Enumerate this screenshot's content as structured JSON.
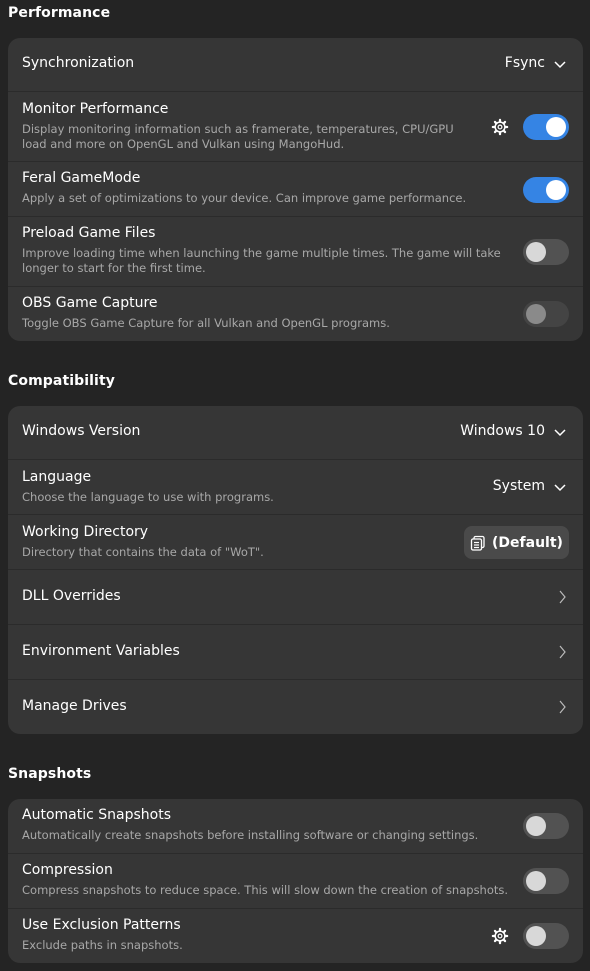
{
  "performance": {
    "title": "Performance",
    "synchronization": {
      "label": "Synchronization",
      "value": "Fsync"
    },
    "monitor": {
      "label": "Monitor Performance",
      "description": "Display monitoring information such as framerate, temperatures, CPU/GPU load and more on OpenGL and Vulkan using MangoHud.",
      "enabled": true
    },
    "gamemode": {
      "label": "Feral GameMode",
      "description": "Apply a set of optimizations to your device. Can improve game performance.",
      "enabled": true
    },
    "preload": {
      "label": "Preload Game Files",
      "description": "Improve loading time when launching the game multiple times. The game will take longer to start for the first time.",
      "enabled": false
    },
    "obs": {
      "label": "OBS Game Capture",
      "description": "Toggle OBS Game Capture for all Vulkan and OpenGL programs.",
      "enabled": false
    }
  },
  "compatibility": {
    "title": "Compatibility",
    "windows_version": {
      "label": "Windows Version",
      "value": "Windows 10"
    },
    "language": {
      "label": "Language",
      "description": "Choose the language to use with programs.",
      "value": "System"
    },
    "working_directory": {
      "label": "Working Directory",
      "description": "Directory that contains the data of \"WoT\".",
      "button": "(Default)"
    },
    "dll_overrides": {
      "label": "DLL Overrides"
    },
    "env_vars": {
      "label": "Environment Variables"
    },
    "manage_drives": {
      "label": "Manage Drives"
    }
  },
  "snapshots": {
    "title": "Snapshots",
    "automatic": {
      "label": "Automatic Snapshots",
      "description": "Automatically create snapshots before installing software or changing settings.",
      "enabled": false
    },
    "compression": {
      "label": "Compression",
      "description": "Compress snapshots to reduce space. This will slow down the creation of snapshots.",
      "enabled": false
    },
    "exclusion": {
      "label": "Use Exclusion Patterns",
      "description": "Exclude paths in snapshots.",
      "enabled": false
    }
  },
  "colors": {
    "background": "#242424",
    "card": "#363636",
    "accent": "#3584e4",
    "switch_off": "#525252"
  },
  "icons": [
    "chevron-down-icon",
    "chevron-right-icon",
    "gear-icon",
    "folder-icon"
  ]
}
